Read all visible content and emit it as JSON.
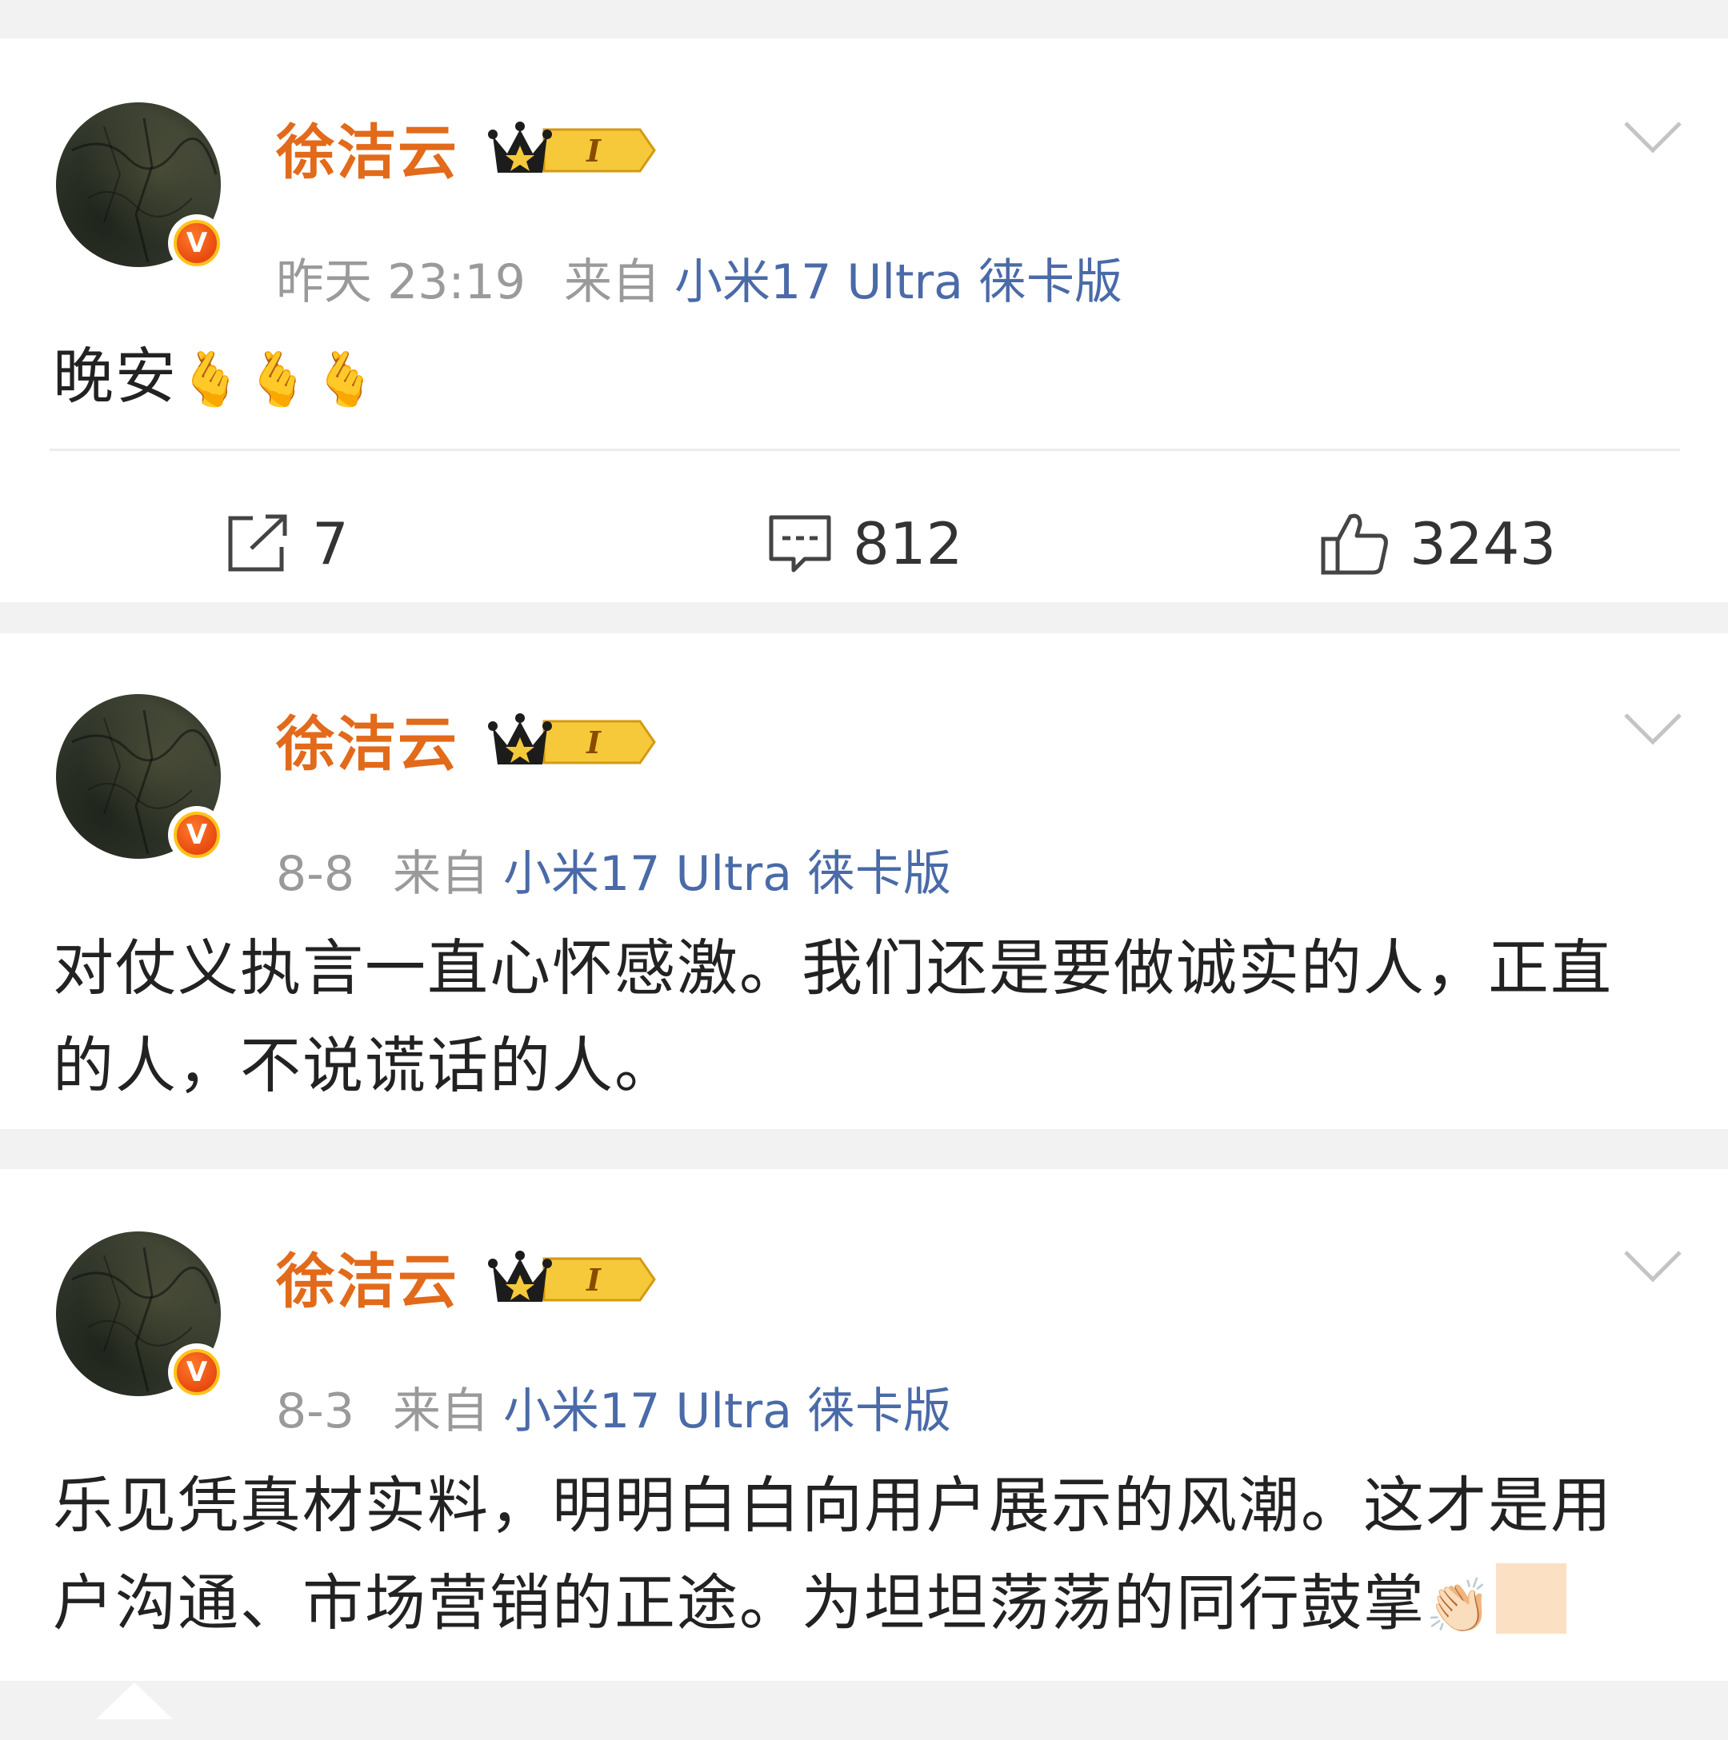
{
  "posts": [
    {
      "username": "徐洁云",
      "vip_level": "I",
      "verified": "V",
      "time": "昨天 23:19",
      "source_prefix": "来自",
      "device": "小米17 Ultra 徕卡版",
      "text": "晚安",
      "text_emoji": "🫰🫰🫰",
      "reposts": "7",
      "comments": "812",
      "likes": "3243"
    },
    {
      "username": "徐洁云",
      "vip_level": "I",
      "verified": "V",
      "time": "8-8",
      "source_prefix": "来自",
      "device": "小米17 Ultra 徕卡版",
      "text": "对仗义执言一直心怀感激。我们还是要做诚实的人，正直的人，不说谎话的人。"
    },
    {
      "username": "徐洁云",
      "vip_level": "I",
      "verified": "V",
      "time": "8-3",
      "source_prefix": "来自",
      "device": "小米17 Ultra 徕卡版",
      "text": "乐见凭真材实料，明明白白向用户展示的风潮。这才是用户沟通、市场营销的正途。为坦坦荡荡的同行鼓掌",
      "text_emoji": "👏🏻"
    }
  ],
  "colors": {
    "username": "#e26a1b",
    "device_link": "#4a6aa8",
    "meta": "#9a9a9a",
    "page_bg": "#f2f2f2"
  },
  "icons": {
    "more": "chevron-down-icon",
    "repost": "repost-icon",
    "comment": "comment-icon",
    "like": "thumbs-up-icon"
  }
}
